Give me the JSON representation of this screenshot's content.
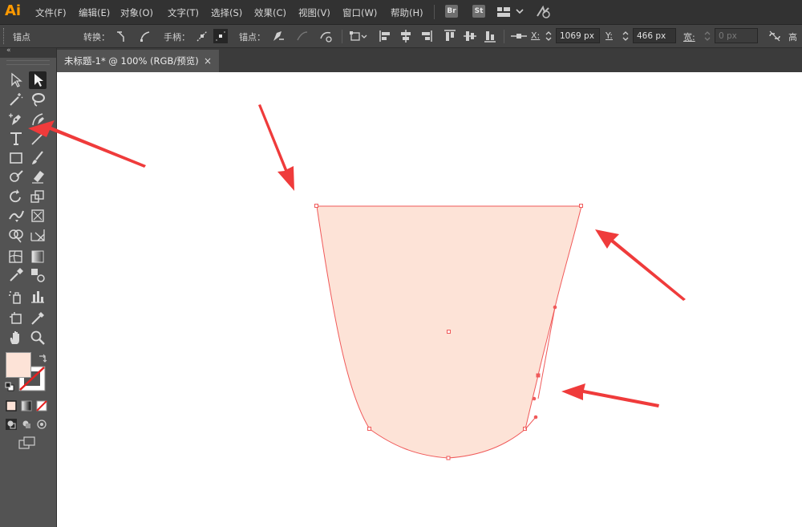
{
  "app": {
    "logo": "Ai"
  },
  "menu": [
    "文件(F)",
    "编辑(E)",
    "对象(O)",
    "文字(T)",
    "选择(S)",
    "效果(C)",
    "视图(V)",
    "窗口(W)",
    "帮助(H)"
  ],
  "badges": {
    "bridge": "Br",
    "stock": "St"
  },
  "control": {
    "mode_label": "锚点",
    "convert_label": "转换：",
    "handles_label": "手柄：",
    "anchors_label": "锚点：",
    "x_label": "X:",
    "x_value": "1069 px",
    "y_label": "Y:",
    "y_value": "466 px",
    "w_label": "宽:",
    "w_value": "0 px",
    "h_label": "高"
  },
  "document": {
    "tab_title": "未标题-1* @ 100% (RGB/预览)",
    "close_glyph": "×"
  },
  "colors": {
    "shape_fill": "#fde3d7",
    "shape_stroke": "#f05a5a",
    "fill_swatch": "#fde3d7",
    "arrow": "#ef3b3b",
    "logo": "#ff9a00"
  },
  "icons": {
    "selection": "selection-tool-icon",
    "direct_selection": "direct-selection-tool-icon",
    "pen": "pen-tool-icon"
  }
}
